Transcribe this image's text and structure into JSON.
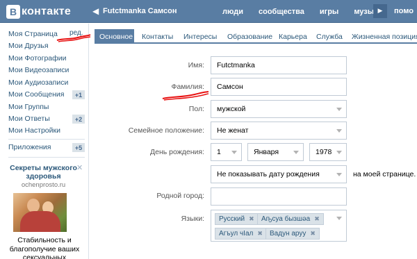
{
  "header": {
    "logo_letter": "В",
    "logo_text": "контакте",
    "back_glyph": "◀",
    "user_name": "Futctmanka Самсон",
    "nav": [
      "люди",
      "сообщества",
      "игры",
      "музыка"
    ],
    "help": "помо"
  },
  "sidebar": {
    "items": [
      {
        "label": "Моя Страница"
      },
      {
        "label": "Мои Друзья"
      },
      {
        "label": "Мои Фотографии"
      },
      {
        "label": "Мои Видеозаписи"
      },
      {
        "label": "Мои Аудиозаписи"
      },
      {
        "label": "Мои Сообщения",
        "badge": "+1"
      },
      {
        "label": "Мои Группы"
      },
      {
        "label": "Мои Ответы",
        "badge": "+2"
      },
      {
        "label": "Мои Настройки"
      },
      {
        "label": "Приложения",
        "badge": "+5"
      }
    ],
    "edit_label": "ред.",
    "ad": {
      "title": "Секреты мужского здоровья",
      "domain": "ochenprosto.ru",
      "description": "Стабильность и благополучие ваших сексуальных"
    }
  },
  "tabs": [
    {
      "label": "Основное",
      "active": true
    },
    {
      "label": "Контакты"
    },
    {
      "label": "Интересы"
    },
    {
      "label": "Образование"
    },
    {
      "label": "Карьера"
    },
    {
      "label": "Служба"
    },
    {
      "label": "Жизненная позиция"
    }
  ],
  "form": {
    "first_name_label": "Имя:",
    "first_name_value": "Futctmanka",
    "last_name_label": "Фамилия:",
    "last_name_value": "Самсон",
    "gender_label": "Пол:",
    "gender_value": "мужской",
    "marital_label": "Семейное положение:",
    "marital_value": "Не женат",
    "birthday_label": "День рождения:",
    "birth_day": "1",
    "birth_month": "Января",
    "birth_year": "1978",
    "birthday_visibility": "Не показывать дату рождения",
    "birthday_note": "на моей странице.",
    "hometown_label": "Родной город:",
    "hometown_value": "",
    "languages_label": "Языки:",
    "languages": [
      "Русский",
      "Аҧсуа бызшәа",
      "Агъул чIал",
      "Вадун аруу"
    ]
  },
  "colors": {
    "header": "#597da3",
    "link": "#2b587a",
    "badge_bg": "#dae2e8",
    "annotation": "#e81010"
  },
  "icons": {
    "close": "close-icon",
    "dropdown": "chevron-down-icon",
    "play": "play-icon"
  }
}
